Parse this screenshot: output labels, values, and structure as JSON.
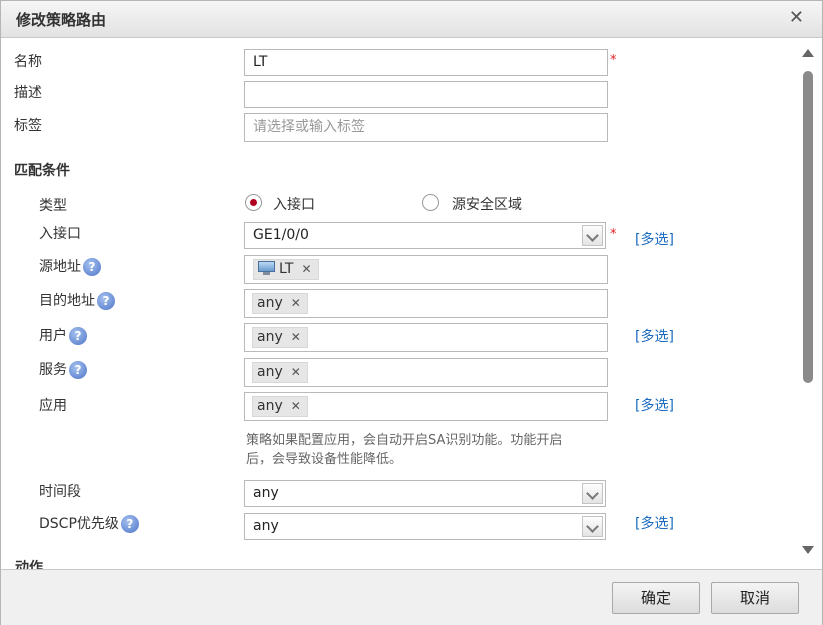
{
  "dialog": {
    "title": "修改策略路由",
    "close_glyph": "✕"
  },
  "form": {
    "name": {
      "label": "名称",
      "value": "LT",
      "required": "*"
    },
    "desc": {
      "label": "描述",
      "value": ""
    },
    "tags": {
      "label": "标签",
      "placeholder": "请选择或输入标签"
    }
  },
  "match": {
    "section_title": "匹配条件",
    "type": {
      "label": "类型",
      "options": [
        "入接口",
        "源安全区域"
      ],
      "selected": "入接口"
    },
    "interface": {
      "label": "入接口",
      "value": "GE1/0/0",
      "required": "*",
      "multi": "[多选]"
    },
    "src_addr": {
      "label": "源地址",
      "tag": "LT"
    },
    "dst_addr": {
      "label": "目的地址",
      "tag": "any"
    },
    "user": {
      "label": "用户",
      "tag": "any",
      "multi": "[多选]"
    },
    "service": {
      "label": "服务",
      "tag": "any"
    },
    "app": {
      "label": "应用",
      "tag": "any",
      "multi": "[多选]",
      "note_line1": "策略如果配置应用，会自动开启SA识别功能。功能开启",
      "note_line2": "后，会导致设备性能降低。"
    },
    "time": {
      "label": "时间段",
      "value": "any"
    },
    "dscp": {
      "label": "DSCP优先级",
      "value": "any",
      "multi": "[多选]"
    }
  },
  "partial_section": "动作",
  "help_glyph": "?",
  "tag_remove_glyph": "✕",
  "footer": {
    "ok": "确定",
    "cancel": "取消"
  },
  "colors": {
    "accent_link": "#1a6bbf",
    "required": "#e02020",
    "radio_selected": "#b00020"
  }
}
